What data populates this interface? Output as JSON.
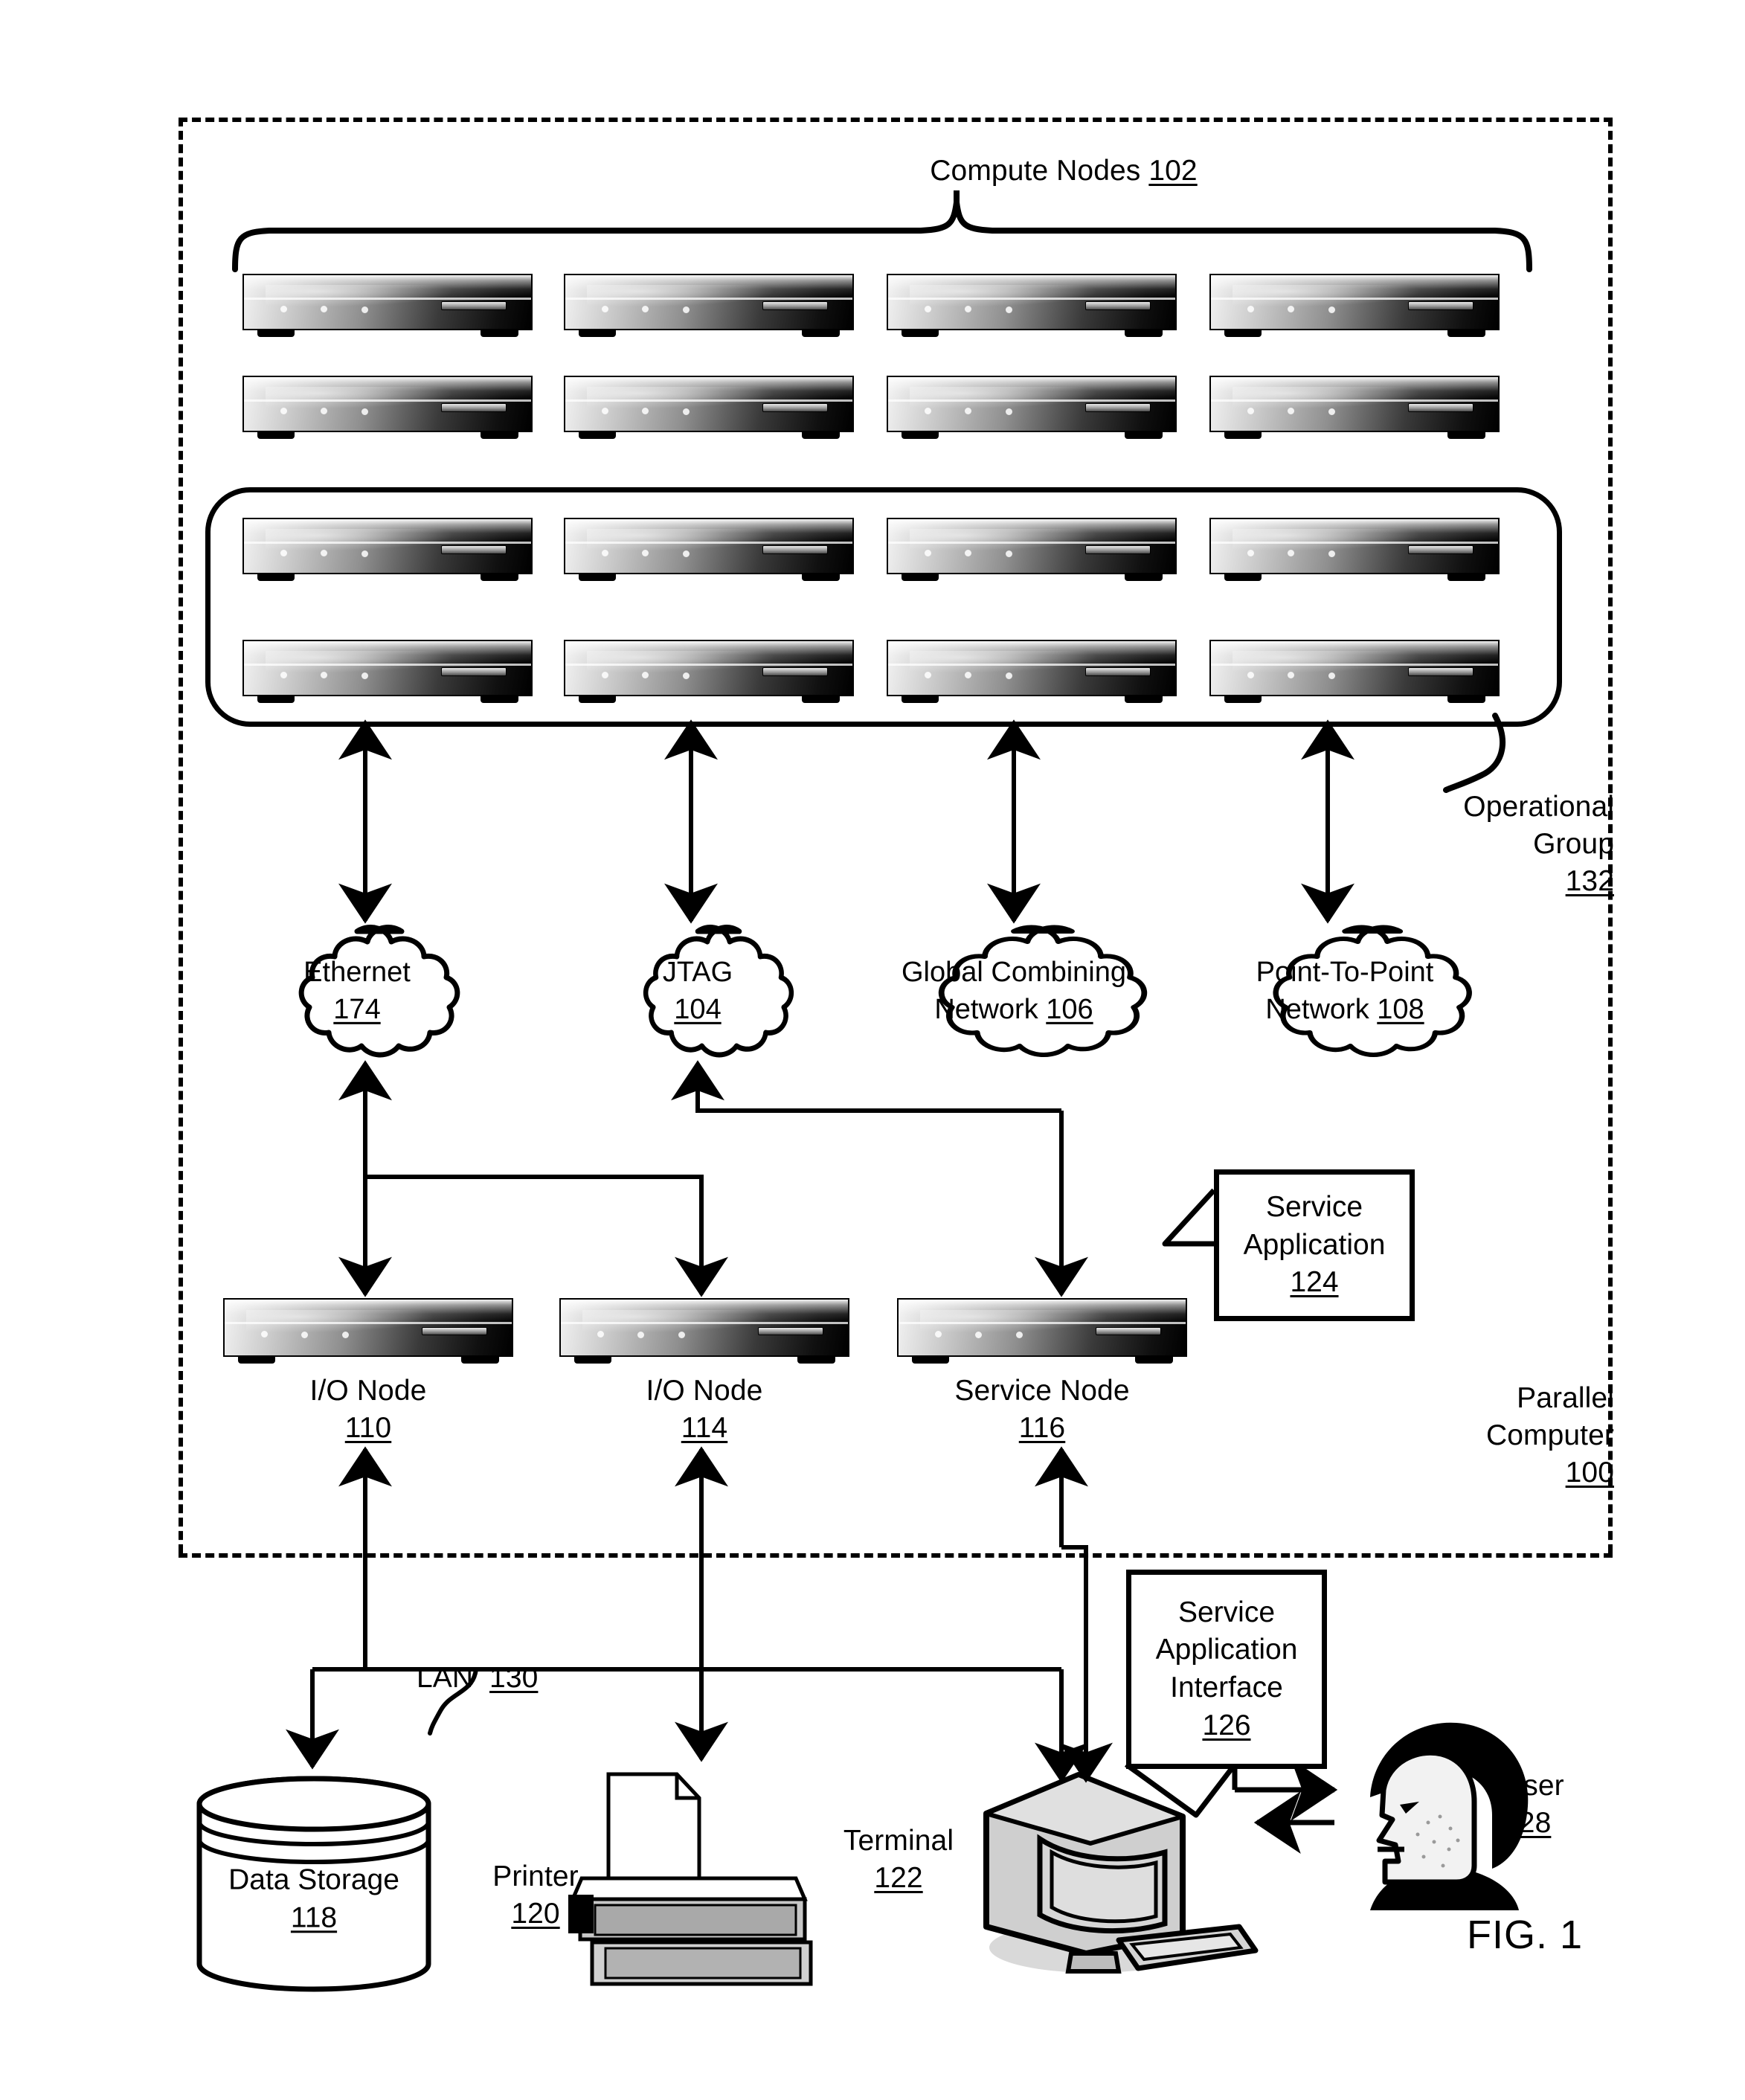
{
  "figure": {
    "caption": "FIG. 1",
    "title": "Parallel Computer",
    "ink": "#000000",
    "paper": "#ffffff"
  },
  "frame": {
    "label_line1": "Parallel",
    "label_line2": "Computer",
    "label_number": "100"
  },
  "compute_nodes": {
    "label": "Compute Nodes",
    "number": "102",
    "rows_outside_group": 2,
    "cols": 4,
    "rows_in_group": 2
  },
  "operational_group": {
    "label_line1": "Operational",
    "label_line2": "Group",
    "number": "132"
  },
  "networks": [
    {
      "name": "ethernet",
      "line1": "Ethernet",
      "line2": "",
      "number": "174"
    },
    {
      "name": "jtag",
      "line1": "JTAG",
      "line2": "",
      "number": "104"
    },
    {
      "name": "global-combining",
      "line1": "Global Combining",
      "line2": "Network",
      "number": "106"
    },
    {
      "name": "point-to-point",
      "line1": "Point-To-Point",
      "line2": "Network",
      "number": "108"
    }
  ],
  "service_nodes": [
    {
      "name": "io-node-110",
      "label": "I/O Node",
      "number": "110"
    },
    {
      "name": "io-node-114",
      "label": "I/O Node",
      "number": "114"
    },
    {
      "name": "service-node",
      "label": "Service Node",
      "number": "116"
    }
  ],
  "service_application": {
    "line1": "Service",
    "line2": "Application",
    "number": "124"
  },
  "service_application_interface": {
    "line1": "Service",
    "line2": "Application",
    "line3": "Interface",
    "number": "126"
  },
  "lan": {
    "label": "LAN",
    "number": "130"
  },
  "peripherals": [
    {
      "name": "data-storage",
      "label": "Data Storage",
      "number": "118"
    },
    {
      "name": "printer",
      "label": "Printer",
      "number": "120"
    },
    {
      "name": "terminal",
      "label": "Terminal",
      "number": "122"
    },
    {
      "name": "user",
      "label": "User",
      "number": "128"
    }
  ]
}
